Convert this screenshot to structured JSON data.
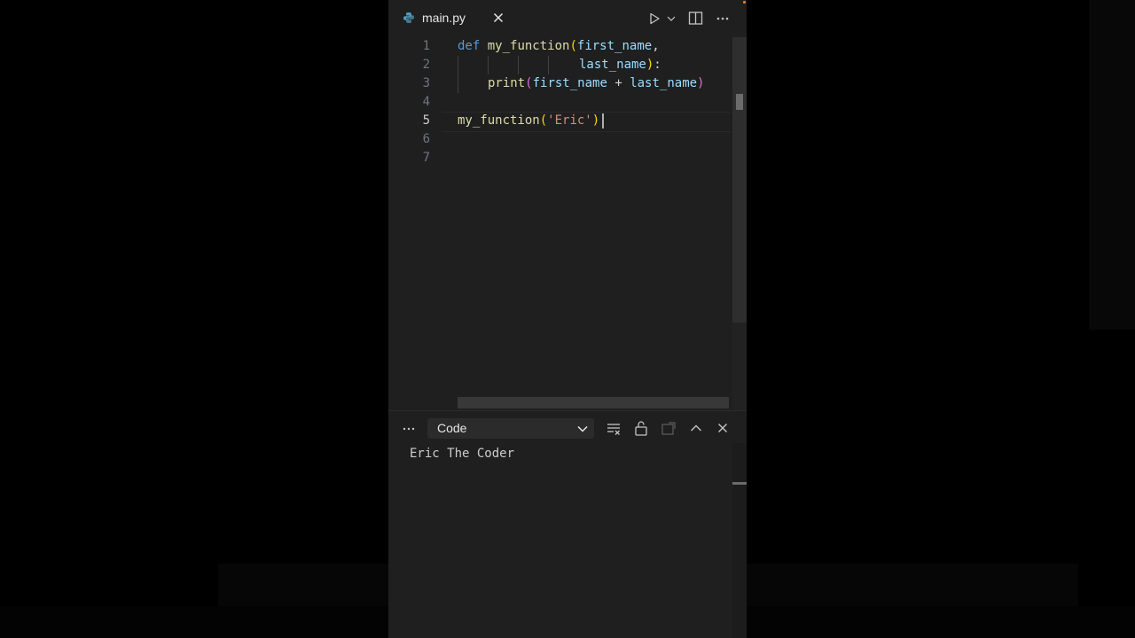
{
  "tab": {
    "filename": "main.py"
  },
  "editor": {
    "line_numbers": [
      "1",
      "2",
      "3",
      "4",
      "5",
      "6",
      "7"
    ],
    "active_line": "5",
    "code": {
      "l1": {
        "kw": "def",
        "fn": "my_function",
        "open": "(",
        "p1": "first_name",
        "comma": ","
      },
      "l2": {
        "p2": "last_name",
        "close": ")",
        "colon": ":"
      },
      "l3": {
        "fn": "print",
        "open": "(",
        "a": "first_name",
        "op": " + ",
        "b": "last_name",
        "close": ")"
      },
      "l5": {
        "fn": "my_function",
        "open": "(",
        "str": "'Eric'",
        "close": ")"
      }
    }
  },
  "output": {
    "channel": "Code",
    "text": "Eric The Coder"
  },
  "icons": {
    "file": "python-file-icon",
    "close": "close-icon",
    "run": "run-icon",
    "run_menu": "chevron-down-icon",
    "split": "split-editor-icon",
    "more": "more-actions-icon",
    "panel_more": "more-actions-icon",
    "clear": "clear-output-icon",
    "lock": "lock-scroll-icon",
    "open_editor": "open-in-editor-icon",
    "maximize": "chevron-up-icon",
    "panel_close": "close-icon"
  },
  "colors": {
    "editor_bg": "#1f1f1f",
    "keyword": "#569cd6",
    "function": "#dcdcaa",
    "parameter": "#9cdcfe",
    "string": "#ce9178"
  }
}
